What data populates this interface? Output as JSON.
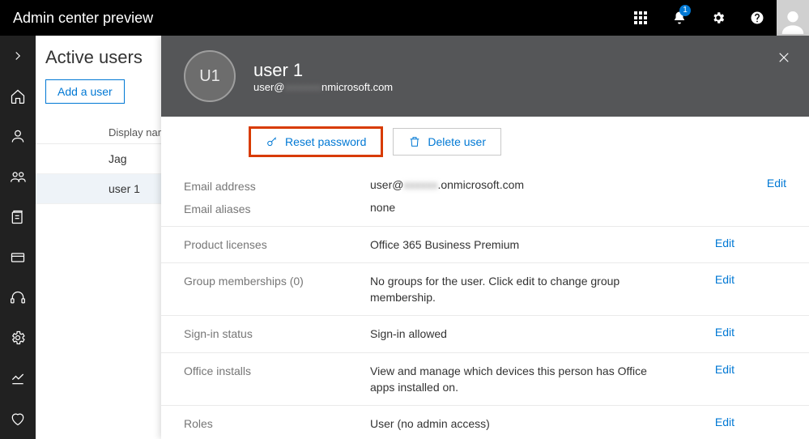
{
  "topbar": {
    "title": "Admin center preview",
    "notification_count": "1"
  },
  "page": {
    "header": "Active users",
    "add_user_label": "Add a user",
    "column_header": "Display name",
    "rows": [
      "Jag",
      "user 1"
    ]
  },
  "flyout": {
    "avatar_initials": "U1",
    "name": "user 1",
    "email_masked_prefix": "user@",
    "email_masked_mid": "xxxxxxx",
    "email_masked_suffix": "nmicrosoft.com",
    "reset_password_label": "Reset password",
    "delete_user_label": "Delete user",
    "edit_label": "Edit",
    "rows": {
      "email_address_label": "Email address",
      "email_address_value_prefix": "user@",
      "email_address_value_mid": "xxxxxx",
      "email_address_value_suffix": ".onmicrosoft.com",
      "email_aliases_label": "Email aliases",
      "email_aliases_value": "none",
      "product_licenses_label": "Product licenses",
      "product_licenses_value": "Office 365 Business Premium",
      "group_memberships_label": "Group memberships (0)",
      "group_memberships_value": "No groups for the user. Click edit to change group membership.",
      "signin_status_label": "Sign-in status",
      "signin_status_value": "Sign-in allowed",
      "office_installs_label": "Office installs",
      "office_installs_value": "View and manage which devices this person has Office apps installed on.",
      "roles_label": "Roles",
      "roles_value": "User (no admin access)"
    }
  }
}
